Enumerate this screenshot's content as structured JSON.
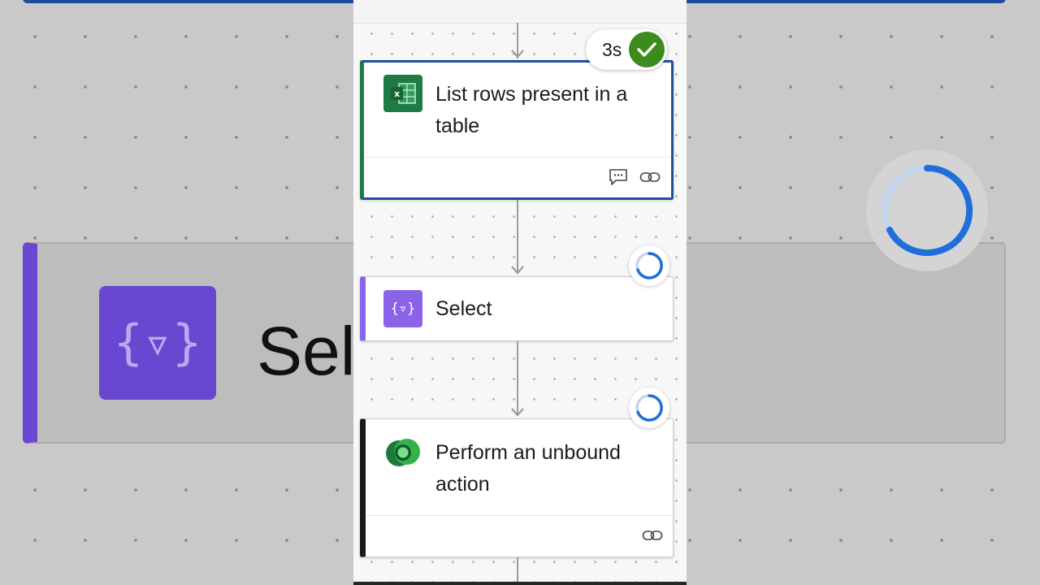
{
  "flow": {
    "steps": [
      {
        "title": "List rows present in a table",
        "connector": "Excel Online",
        "icon": "excel-icon",
        "accent": "#1f7a44",
        "status": "succeeded",
        "duration": "3s",
        "footer_icons": [
          "comment-icon",
          "link-icon"
        ]
      },
      {
        "title": "Select",
        "connector": "Data Operation",
        "icon": "data-operation-icon",
        "accent": "#8b63e8",
        "status": "running"
      },
      {
        "title": "Perform an unbound action",
        "connector": "Dataverse",
        "icon": "dataverse-icon",
        "accent": "#1a1a1a",
        "status": "running",
        "footer_icons": [
          "link-icon"
        ]
      }
    ]
  },
  "backdrop": {
    "zoomed_label": "Sele"
  },
  "colors": {
    "selected_border": "#1f4fa0",
    "success": "#3d8a1d",
    "spinner": "#1e6fd9",
    "excel": "#1f7a44",
    "data_operation": "#8b63e8",
    "dataverse": "#34b24a"
  }
}
